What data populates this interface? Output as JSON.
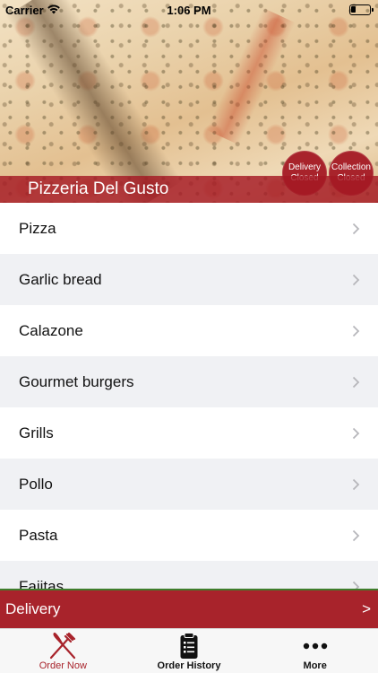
{
  "status_bar": {
    "carrier": "Carrier",
    "time": "1:06 PM"
  },
  "header": {
    "restaurant_name": "Pizzeria Del Gusto",
    "badges": {
      "delivery": {
        "line1": "Delivery",
        "line2": "Closed"
      },
      "collection": {
        "line1": "Collection",
        "line2": "Closed"
      }
    }
  },
  "menu": {
    "items": [
      {
        "label": "Pizza"
      },
      {
        "label": "Garlic bread"
      },
      {
        "label": "Calazone"
      },
      {
        "label": "Gourmet burgers"
      },
      {
        "label": "Grills"
      },
      {
        "label": "Pollo"
      },
      {
        "label": "Pasta"
      },
      {
        "label": "Fajitas"
      }
    ]
  },
  "delivery_bar": {
    "label": "Delivery",
    "arrow": ">"
  },
  "tab_bar": {
    "tabs": [
      {
        "label": "Order Now",
        "icon": "fork-knife-icon"
      },
      {
        "label": "Order History",
        "icon": "clipboard-list-icon"
      },
      {
        "label": "More",
        "icon": "more-dots-icon"
      }
    ]
  },
  "colors": {
    "brand_red": "#a8232b",
    "list_alt_bg": "#f0f1f4"
  }
}
